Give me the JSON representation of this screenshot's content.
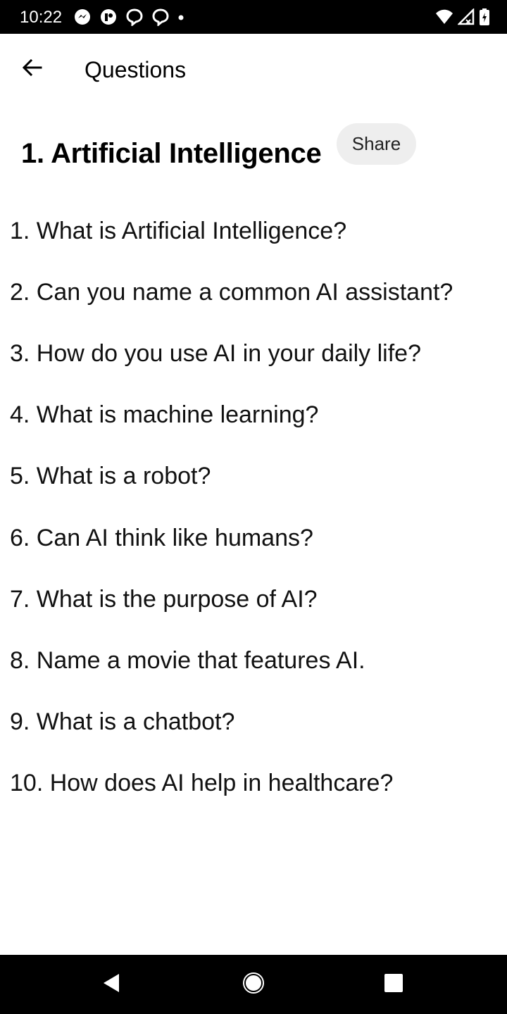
{
  "status_bar": {
    "time": "10:22",
    "left_icons": [
      "messenger-icon",
      "app-notification-icon",
      "chat-bubble-icon",
      "chat-bubble-icon",
      "dot-icon"
    ],
    "right_icons": [
      "wifi-icon",
      "signal-icon",
      "battery-icon"
    ]
  },
  "app_bar": {
    "back_icon": "arrow-left-icon",
    "title": "Questions"
  },
  "section": {
    "title": "1. Artificial Intelligence",
    "share_label": "Share"
  },
  "questions": [
    "1. What is Artificial Intelligence?",
    "2. Can you name a common AI assistant?",
    "3. How do you use AI in your daily life?",
    "4. What is machine learning?",
    "5. What is a robot?",
    "6. Can AI think like humans?",
    "7. What is the purpose of AI?",
    "8. Name a movie that features AI.",
    "9. What is a chatbot?",
    "10. How does AI help in healthcare?"
  ],
  "nav_bar": {
    "buttons": [
      "back-triangle-icon",
      "home-circle-icon",
      "recents-square-icon"
    ]
  },
  "colors": {
    "status_bar_bg": "#000000",
    "nav_bar_bg": "#000000",
    "share_button_bg": "#eeeeee",
    "text": "#000000"
  }
}
